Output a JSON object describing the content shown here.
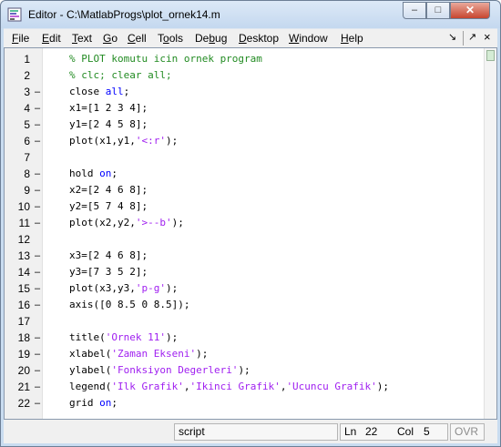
{
  "window": {
    "title": "Editor - C:\\MatlabProgs\\plot_ornek14.m",
    "min_glyph": "–",
    "max_glyph": "□",
    "close_glyph": "✕"
  },
  "menu": {
    "items": [
      {
        "accel": "F",
        "rest": "ile"
      },
      {
        "accel": "E",
        "rest": "dit"
      },
      {
        "accel": "T",
        "rest": "ext"
      },
      {
        "accel": "G",
        "rest": "o"
      },
      {
        "accel": "C",
        "rest": "ell"
      },
      {
        "pre": "T",
        "accel": "o",
        "rest": "ols"
      },
      {
        "pre": "De",
        "accel": "b",
        "rest": "ug"
      },
      {
        "accel": "D",
        "rest": "esktop"
      },
      {
        "accel": "W",
        "rest": "indow"
      },
      {
        "accel": "H",
        "rest": "elp"
      }
    ],
    "undock_glyph": "↘",
    "pin_glyph": "↗",
    "close_glyph": "×"
  },
  "code": {
    "lines": [
      {
        "num": "1",
        "dash": "",
        "tokens": [
          [
            "c",
            "% PLOT komutu icin ornek program"
          ]
        ]
      },
      {
        "num": "2",
        "dash": "",
        "tokens": [
          [
            "c",
            "% clc; clear all;"
          ]
        ]
      },
      {
        "num": "3",
        "dash": "–",
        "tokens": [
          [
            "p",
            "close "
          ],
          [
            "k",
            "all"
          ],
          [
            "p",
            ";"
          ]
        ]
      },
      {
        "num": "4",
        "dash": "–",
        "tokens": [
          [
            "p",
            "x1=[1 2 3 4];"
          ]
        ]
      },
      {
        "num": "5",
        "dash": "–",
        "tokens": [
          [
            "p",
            "y1=[2 4 5 8];"
          ]
        ]
      },
      {
        "num": "6",
        "dash": "–",
        "tokens": [
          [
            "p",
            "plot(x1,y1,"
          ],
          [
            "s",
            "'<:r'"
          ],
          [
            "p",
            ");"
          ]
        ]
      },
      {
        "num": "7",
        "dash": "",
        "tokens": []
      },
      {
        "num": "8",
        "dash": "–",
        "tokens": [
          [
            "p",
            "hold "
          ],
          [
            "k",
            "on"
          ],
          [
            "p",
            ";"
          ]
        ]
      },
      {
        "num": "9",
        "dash": "–",
        "tokens": [
          [
            "p",
            "x2=[2 4 6 8];"
          ]
        ]
      },
      {
        "num": "10",
        "dash": "–",
        "tokens": [
          [
            "p",
            "y2=[5 7 4 8];"
          ]
        ]
      },
      {
        "num": "11",
        "dash": "–",
        "tokens": [
          [
            "p",
            "plot(x2,y2,"
          ],
          [
            "s",
            "'>--b'"
          ],
          [
            "p",
            ");"
          ]
        ]
      },
      {
        "num": "12",
        "dash": "",
        "tokens": []
      },
      {
        "num": "13",
        "dash": "–",
        "tokens": [
          [
            "p",
            "x3=[2 4 6 8];"
          ]
        ]
      },
      {
        "num": "14",
        "dash": "–",
        "tokens": [
          [
            "p",
            "y3=[7 3 5 2];"
          ]
        ]
      },
      {
        "num": "15",
        "dash": "–",
        "tokens": [
          [
            "p",
            "plot(x3,y3,"
          ],
          [
            "s",
            "'p-g'"
          ],
          [
            "p",
            ");"
          ]
        ]
      },
      {
        "num": "16",
        "dash": "–",
        "tokens": [
          [
            "p",
            "axis([0 8.5 0 8.5]);"
          ]
        ]
      },
      {
        "num": "17",
        "dash": "",
        "tokens": []
      },
      {
        "num": "18",
        "dash": "–",
        "tokens": [
          [
            "p",
            "title("
          ],
          [
            "s",
            "'Ornek 11'"
          ],
          [
            "p",
            ");"
          ]
        ]
      },
      {
        "num": "19",
        "dash": "–",
        "tokens": [
          [
            "p",
            "xlabel("
          ],
          [
            "s",
            "'Zaman Ekseni'"
          ],
          [
            "p",
            ");"
          ]
        ]
      },
      {
        "num": "20",
        "dash": "–",
        "tokens": [
          [
            "p",
            "ylabel("
          ],
          [
            "s",
            "'Fonksiyon Degerleri'"
          ],
          [
            "p",
            ");"
          ]
        ]
      },
      {
        "num": "21",
        "dash": "–",
        "tokens": [
          [
            "p",
            "legend("
          ],
          [
            "s",
            "'Ilk Grafik'"
          ],
          [
            "p",
            ","
          ],
          [
            "s",
            "'Ikinci Grafik'"
          ],
          [
            "p",
            ","
          ],
          [
            "s",
            "'Ucuncu Grafik'"
          ],
          [
            "p",
            ");"
          ]
        ]
      },
      {
        "num": "22",
        "dash": "–",
        "tokens": [
          [
            "p",
            "grid "
          ],
          [
            "k",
            "on"
          ],
          [
            "p",
            ";"
          ]
        ]
      }
    ]
  },
  "status": {
    "mode": "script",
    "ln_label": "Ln",
    "ln_value": "22",
    "col_label": "Col",
    "col_value": "5",
    "ovr": "OVR"
  },
  "colors": {
    "comment": "#228b22",
    "keyword": "#0000ff",
    "string": "#a020f0"
  }
}
